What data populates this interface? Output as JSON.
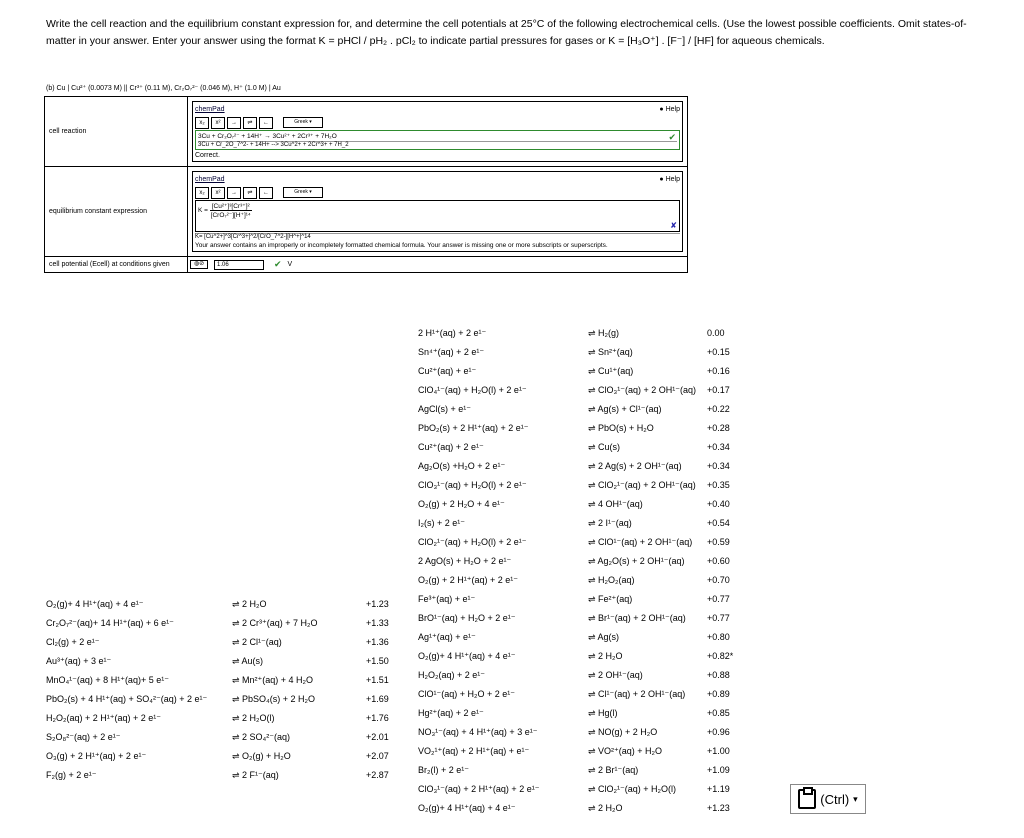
{
  "instructions": "Write the cell reaction and the equilibrium constant expression for, and determine the cell potentials at 25°C of the following electrochemical cells. (Use the lowest possible coefficients. Omit states-of-matter in your answer. Enter your answer using the format K = pHCl / pH₂ . pCl₂ to indicate partial pressures for gases or K = [H₃O⁺] . [F⁻] / [HF] for aqueous chemicals.",
  "part_label": "(b) Cu | Cu²⁺ (0.0073 M) || Cr³⁺ (0.11 M), Cr₂O₇²⁻ (0.046 M), H⁺ (1.0 M) | Au",
  "row1": {
    "label": "cell reaction",
    "pad_title": "chemPad",
    "help": "Help",
    "greek": "Greek",
    "answer": "3Cu + Cr₂O₇²⁻ + 14H⁺ → 3Cu²⁺ + 2Cr³⁺ + 7H₂O",
    "raw": "3Cu + Cr_2O_7^2- + 14H+ --> 3Cu^2+ + 2Cr^3+ + 7H_2",
    "status": "Correct."
  },
  "row2": {
    "label": "equilibrium constant expression",
    "pad_title": "chemPad",
    "help": "Help",
    "greek": "Greek",
    "k_prefix": "K =",
    "numerator": "[Cu²⁺]³[Cr³⁺]²",
    "denominator": "[CrO₇²⁻][H⁺]¹⁴",
    "raw": "K= [Cu^2+]^3[Cr^3+]^2/[CrO_7^2-][H^+]^14",
    "error": "Your answer contains an improperly or incompletely formatted chemical formula. Your answer is missing one or more subscripts or superscripts."
  },
  "row3": {
    "label": "cell potential (Ecell) at conditions given",
    "value": "1.06",
    "unit": "V"
  },
  "right_table": [
    {
      "left": "2 H¹⁺(aq) + 2 e¹⁻",
      "right": "⇌ H₂(g)",
      "value": "0.00"
    },
    {
      "left": "Sn⁴⁺(aq) + 2 e¹⁻",
      "right": "⇌ Sn²⁺(aq)",
      "value": "+0.15"
    },
    {
      "left": "Cu²⁺(aq) + e¹⁻",
      "right": "⇌ Cu¹⁺(aq)",
      "value": "+0.16"
    },
    {
      "left": "ClO₄¹⁻(aq) + H₂O(l) + 2 e¹⁻",
      "right": "⇌ ClO₃¹⁻(aq) + 2 OH¹⁻(aq)",
      "value": "+0.17"
    },
    {
      "left": "AgCl(s) + e¹⁻",
      "right": "⇌ Ag(s) + Cl¹⁻(aq)",
      "value": "+0.22"
    },
    {
      "left": "PbO₂(s) + 2 H¹⁺(aq) + 2 e¹⁻",
      "right": "⇌ PbO(s) + H₂O",
      "value": "+0.28"
    },
    {
      "left": "Cu²⁺(aq) + 2 e¹⁻",
      "right": "⇌ Cu(s)",
      "value": "+0.34"
    },
    {
      "left": "Ag₂O(s) +H₂O + 2 e¹⁻",
      "right": "⇌ 2 Ag(s) + 2 OH¹⁻(aq)",
      "value": "+0.34"
    },
    {
      "left": "ClO₃¹⁻(aq) + H₂O(l) + 2 e¹⁻",
      "right": "⇌ ClO₂¹⁻(aq) + 2 OH¹⁻(aq)",
      "value": "+0.35"
    },
    {
      "left": "O₂(g) + 2 H₂O + 4 e¹⁻",
      "right": "⇌ 4 OH¹⁻(aq)",
      "value": "+0.40"
    },
    {
      "left": "I₂(s) + 2 e¹⁻",
      "right": "⇌ 2 I¹⁻(aq)",
      "value": "+0.54"
    },
    {
      "left": "ClO₂¹⁻(aq) + H₂O(l) + 2 e¹⁻",
      "right": "⇌ ClO¹⁻(aq) + 2 OH¹⁻(aq)",
      "value": "+0.59"
    },
    {
      "left": "2 AgO(s) + H₂O + 2 e¹⁻",
      "right": "⇌ Ag₂O(s) + 2 OH¹⁻(aq)",
      "value": "+0.60"
    },
    {
      "left": "O₂(g) + 2 H¹⁺(aq) + 2 e¹⁻",
      "right": "⇌ H₂O₂(aq)",
      "value": "+0.70"
    },
    {
      "left": "Fe³⁺(aq) + e¹⁻",
      "right": "⇌ Fe²⁺(aq)",
      "value": "+0.77"
    },
    {
      "left": "BrO¹⁻(aq) + H₂O + 2 e¹⁻",
      "right": "⇌ Br¹⁻(aq) + 2 OH¹⁻(aq)",
      "value": "+0.77"
    },
    {
      "left": "Ag¹⁺(aq) + e¹⁻",
      "right": "⇌ Ag(s)",
      "value": "+0.80"
    },
    {
      "left": "O₂(g)+ 4 H¹⁺(aq) + 4 e¹⁻",
      "right": "⇌ 2 H₂O",
      "value": "+0.82*"
    },
    {
      "left": "H₂O₂(aq) + 2 e¹⁻",
      "right": "⇌ 2 OH¹⁻(aq)",
      "value": "+0.88"
    },
    {
      "left": "ClO¹⁻(aq) + H₂O + 2 e¹⁻",
      "right": "⇌ Cl¹⁻(aq) + 2 OH¹⁻(aq)",
      "value": "+0.89"
    },
    {
      "left": "Hg²⁺(aq) + 2 e¹⁻",
      "right": "⇌ Hg(l)",
      "value": "+0.85"
    },
    {
      "left": "NO₃¹⁻(aq) + 4 H¹⁺(aq) + 3 e¹⁻",
      "right": "⇌ NO(g) + 2 H₂O",
      "value": "+0.96"
    },
    {
      "left": "VO₂¹⁺(aq) + 2 H¹⁺(aq) + e¹⁻",
      "right": "⇌ VO²⁺(aq) + H₂O",
      "value": "+1.00"
    },
    {
      "left": "Br₂(l) + 2 e¹⁻",
      "right": "⇌ 2 Br¹⁻(aq)",
      "value": "+1.09"
    },
    {
      "left": "ClO₃¹⁻(aq) + 2 H¹⁺(aq) + 2 e¹⁻",
      "right": "⇌ ClO₂¹⁻(aq) + H₂O(l)",
      "value": "+1.19"
    },
    {
      "left": "O₂(g)+ 4 H¹⁺(aq) + 4 e¹⁻",
      "right": "⇌ 2 H₂O",
      "value": "+1.23"
    }
  ],
  "left_table": [
    {
      "left": "O₂(g)+ 4 H¹⁺(aq) + 4 e¹⁻",
      "right": "⇌ 2 H₂O",
      "value": "+1.23"
    },
    {
      "left": "Cr₂O₇²⁻(aq)+ 14 H¹⁺(aq) + 6 e¹⁻",
      "right": "⇌ 2 Cr³⁺(aq) + 7 H₂O",
      "value": "+1.33"
    },
    {
      "left": "Cl₂(g) + 2 e¹⁻",
      "right": "⇌ 2 Cl¹⁻(aq)",
      "value": "+1.36"
    },
    {
      "left": "Au³⁺(aq) + 3 e¹⁻",
      "right": "⇌ Au(s)",
      "value": "+1.50"
    },
    {
      "left": "MnO₄¹⁻(aq) + 8 H¹⁺(aq)+ 5 e¹⁻",
      "right": "⇌ Mn²⁺(aq) + 4 H₂O",
      "value": "+1.51"
    },
    {
      "left": "PbO₂(s) + 4 H¹⁺(aq) + SO₄²⁻(aq) + 2 e¹⁻",
      "right": "⇌ PbSO₄(s) + 2 H₂O",
      "value": "+1.69"
    },
    {
      "left": "H₂O₂(aq) + 2 H¹⁺(aq) + 2 e¹⁻",
      "right": "⇌ 2 H₂O(l)",
      "value": "+1.76"
    },
    {
      "left": "S₂O₈²⁻(aq) + 2 e¹⁻",
      "right": "⇌ 2 SO₄²⁻(aq)",
      "value": "+2.01"
    },
    {
      "left": "O₃(g) + 2 H¹⁺(aq) + 2 e¹⁻",
      "right": "⇌ O₂(g) + H₂O",
      "value": "+2.07"
    },
    {
      "left": "F₂(g) + 2 e¹⁻",
      "right": "⇌ 2 F¹⁻(aq)",
      "value": "+2.87"
    }
  ],
  "ctrl_button": "(Ctrl)"
}
